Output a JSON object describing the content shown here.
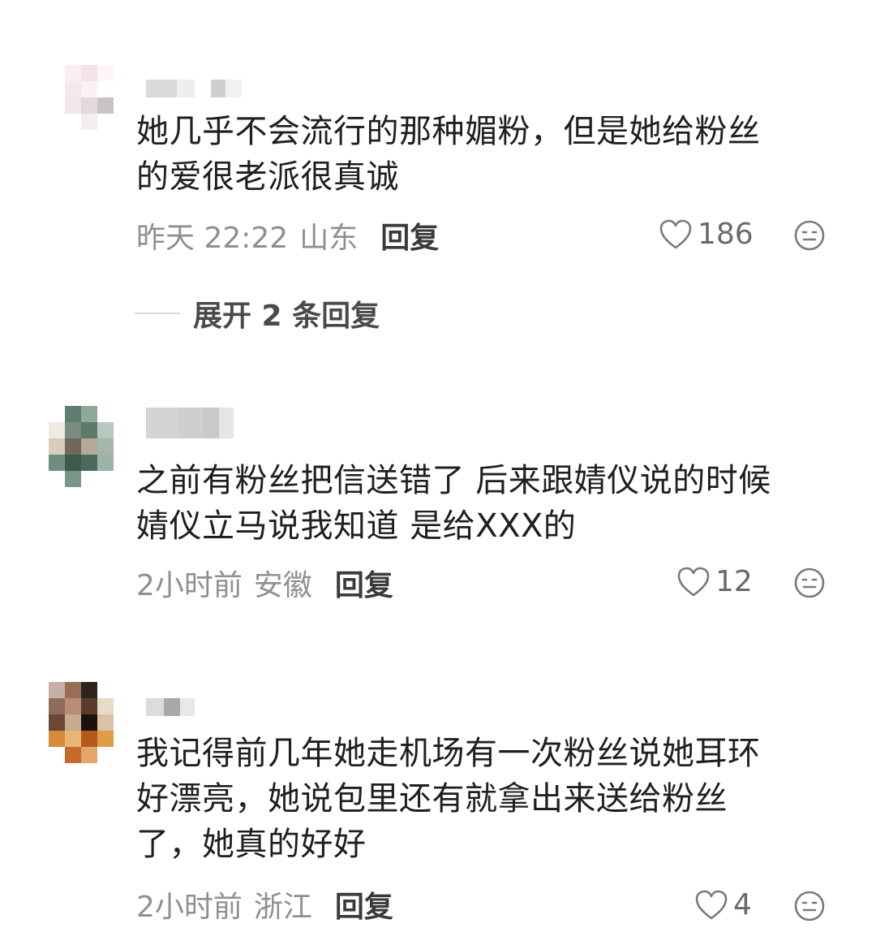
{
  "comments": [
    {
      "text_line1": "她几乎不会流行的那种媚粉，但是她给粉丝",
      "text_line2": "的爱很老派很真诚",
      "text_line3": "",
      "time": "昨天 22:22",
      "location": "山东",
      "reply_label": "回复",
      "likes": "186",
      "avatar_colors": [
        "#ffffff",
        "#fbeef3",
        "#f6e1ea",
        "#fff6f9",
        "#ffffff",
        "#f7e7ee",
        "#fbf2f5",
        "#ffffff",
        "#ffffff",
        "#f2e6ea",
        "#e2d9dc",
        "#c8c3c5",
        "#ffffff",
        "#ffffff",
        "#f5eef1",
        "#ffffff",
        "#ffffff",
        "#ffffff",
        "#ffffff",
        "#ffffff"
      ],
      "username_colors": [
        "#d9d9d9",
        "#eeeeee",
        "#ffffff",
        "#cfcfcf",
        "#f2f2f2"
      ]
    },
    {
      "text_line1": "之前有粉丝把信送错了 后来跟婧仪说的时候",
      "text_line2": "婧仪立马说我知道 是给XXX的",
      "text_line3": "",
      "time": "2小时前",
      "location": "安徽",
      "reply_label": "回复",
      "likes": "12",
      "avatar_colors": [
        "#ffffff",
        "#5f7d6f",
        "#8ea999",
        "#ffffff",
        "#f0ebe2",
        "#7a8c80",
        "#5e7a6c",
        "#b9c7bf",
        "#d7ccbd",
        "#6d6a5c",
        "#b5a997",
        "#a4b5ab",
        "#6e8f80",
        "#3e5a4c",
        "#4a6a5a",
        "#9db3a8",
        "#ffffff",
        "#7b9588",
        "#ffffff",
        "#ffffff"
      ],
      "username_colors": [
        "#d4d4d4",
        "#cfcfcf",
        "#c9c9c9",
        "#e5e5e5"
      ]
    },
    {
      "text_line1": "我记得前几年她走机场有一次粉丝说她耳环",
      "text_line2": "好漂亮，她说包里还有就拿出来送给粉丝",
      "text_line3": "了，她真的好好",
      "time": "2小时前",
      "location": "浙江",
      "reply_label": "回复",
      "likes": "4",
      "avatar_colors": [
        "#c7b0a3",
        "#9a6d57",
        "#2f241e",
        "#ffffff",
        "#8e6b5a",
        "#b88d74",
        "#5a3b2b",
        "#e8d9c9",
        "#6b4737",
        "#c8a991",
        "#1a120e",
        "#d9c2a6",
        "#d68a3b",
        "#e8b574",
        "#b35a1c",
        "#e19a45",
        "#ffffff",
        "#c56a2a",
        "#e3a66a",
        "#ffffff"
      ],
      "username_colors": [
        "#dcdcdc",
        "#a9a9a9",
        "#e8e8e8"
      ]
    }
  ],
  "expand_replies_label": "展开 2 条回复",
  "icons": {
    "like": "heart-outline-icon",
    "emoji": "neutral-face-icon"
  },
  "colors": {
    "text": "#1f1f1f",
    "meta": "#8f8f8f",
    "reply": "#3a3a3a"
  }
}
